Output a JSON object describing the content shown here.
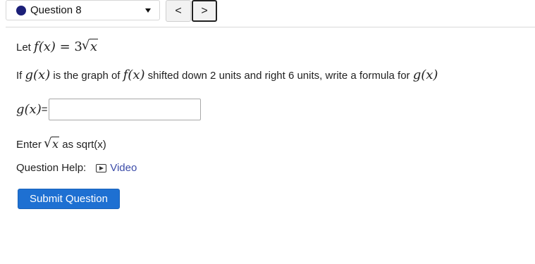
{
  "header": {
    "question_label": "Question 8",
    "status_color": "#1b1f78",
    "prev_label": "<",
    "next_label": ">"
  },
  "question": {
    "let_prefix": "Let ",
    "function_def": {
      "lhs": "f(x)",
      "equals": " = 3",
      "radicand": "x"
    },
    "prompt_parts": [
      "If ",
      "g(x)",
      " is the graph of ",
      "f(x)",
      " shifted down 2 units and right 6 units, write a formula for ",
      "g(x)"
    ],
    "answer_label": "g(x)",
    "answer_suffix": "=",
    "answer_value": "",
    "hint_prefix": "Enter ",
    "hint_radicand": "x",
    "hint_suffix": " as sqrt(x)"
  },
  "help": {
    "label": "Question Help:",
    "video_label": "Video"
  },
  "submit_label": "Submit Question"
}
